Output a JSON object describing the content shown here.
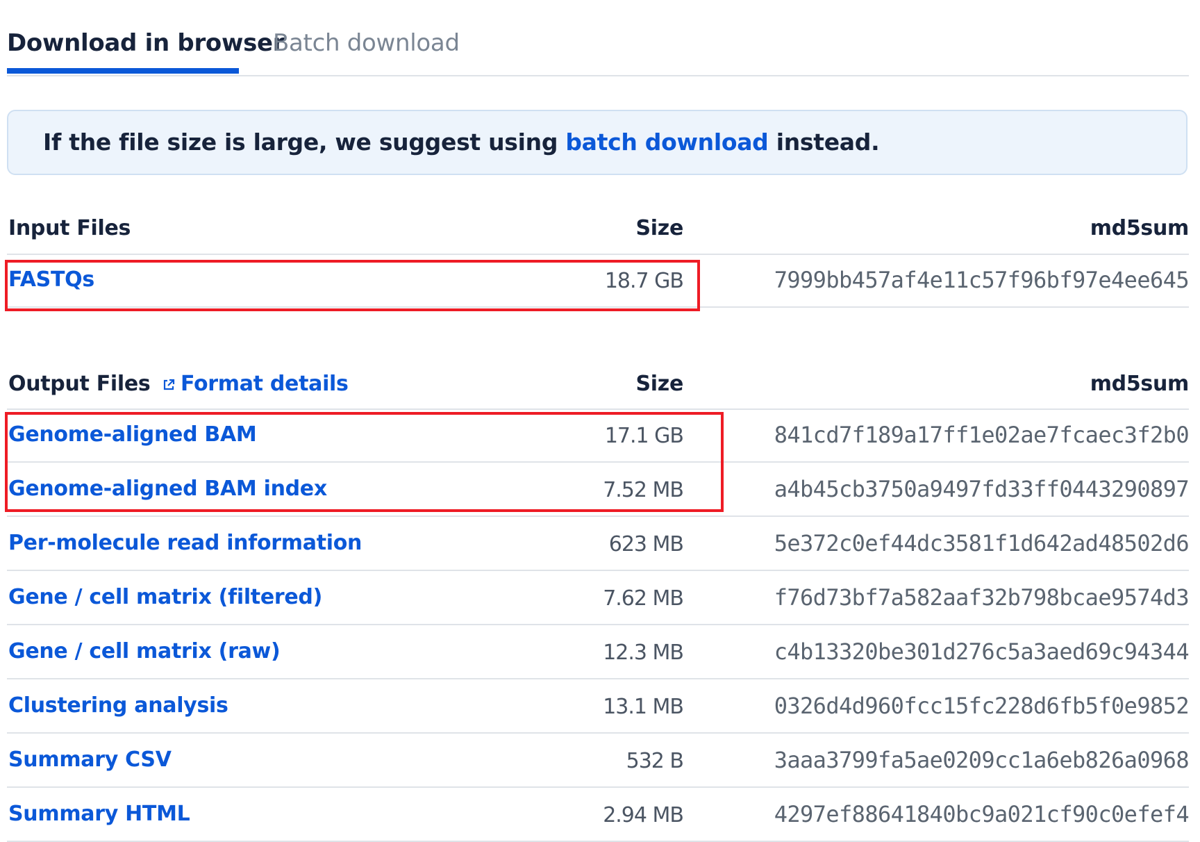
{
  "tabs": {
    "active": "Download in browser",
    "inactive": "Batch download"
  },
  "banner": {
    "prefix": "If the file size is large, we suggest using ",
    "link": "batch download",
    "suffix": " instead."
  },
  "input_section": {
    "title": "Input Files",
    "size_header": "Size",
    "md5_header": "md5sum",
    "rows": [
      {
        "name": "FASTQs",
        "size": "18.7 GB",
        "md5": "7999bb457af4e11c57f96bf97e4ee645"
      }
    ]
  },
  "output_section": {
    "title": "Output Files",
    "format_link": "Format details",
    "size_header": "Size",
    "md5_header": "md5sum",
    "rows": [
      {
        "name": "Genome-aligned BAM",
        "size": "17.1 GB",
        "md5": "841cd7f189a17ff1e02ae7fcaec3f2b0"
      },
      {
        "name": "Genome-aligned BAM index",
        "size": "7.52 MB",
        "md5": "a4b45cb3750a9497fd33ff0443290897"
      },
      {
        "name": "Per-molecule read information",
        "size": "623 MB",
        "md5": "5e372c0ef44dc3581f1d642ad48502d6"
      },
      {
        "name": "Gene / cell matrix (filtered)",
        "size": "7.62 MB",
        "md5": "f76d73bf7a582aaf32b798bcae9574d3"
      },
      {
        "name": "Gene / cell matrix (raw)",
        "size": "12.3 MB",
        "md5": "c4b13320be301d276c5a3aed69c94344"
      },
      {
        "name": "Clustering analysis",
        "size": "13.1 MB",
        "md5": "0326d4d960fcc15fc228d6fb5f0e9852"
      },
      {
        "name": "Summary CSV",
        "size": "532 B",
        "md5": "3aaa3799fa5ae0209cc1a6eb826a0968"
      },
      {
        "name": "Summary HTML",
        "size": "2.94 MB",
        "md5": "4297ef88641840bc9a021cf90c0efef4"
      }
    ]
  },
  "colors": {
    "link": "#0b58d8",
    "highlight": "#ee1c25",
    "banner_bg": "#edf4fc"
  }
}
